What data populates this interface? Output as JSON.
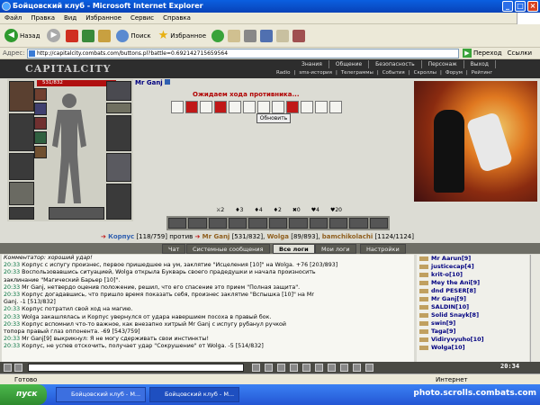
{
  "window": {
    "title": "Бойцовский клуб - Microsoft Internet Explorer"
  },
  "menu": [
    "Файл",
    "Правка",
    "Вид",
    "Избранное",
    "Сервис",
    "Справка"
  ],
  "toolbar": {
    "back": "Назад",
    "search": "Поиск",
    "favorites": "Избранное"
  },
  "address": {
    "label": "Адрес:",
    "url": "http://capitalcity.combats.com/buttons.pl?battle=0.692142715659564",
    "go": "Переход",
    "links": "Ссылки"
  },
  "game": {
    "logo": "CAPITALCITY",
    "top_links": [
      "Знания",
      "Общение",
      "Безопасность",
      "Персонаж",
      "Выход"
    ],
    "sub_links": [
      "Radio",
      "|",
      "sms-история",
      "|",
      "Телеграммы",
      "|",
      "События",
      "|",
      "Скроллы",
      "|",
      "Форум",
      "|",
      "Рейтинг"
    ],
    "player_hp": "531/832",
    "opponent": "Mr Ganj",
    "waiting": "Ожидаем хода противника...",
    "refresh": "Обновить",
    "stats": [
      "2",
      "3",
      "4",
      "2",
      "0",
      "4",
      "20"
    ],
    "vs": {
      "left": "Корпус",
      "left_hp": "[118/759]",
      "word": "против",
      "a": "Mr Ganj",
      "a_hp": "[531/832]",
      "b": "Wolga",
      "b_hp": "[89/893]",
      "c": "bamchikolachi",
      "c_hp": "[1124/1124]"
    }
  },
  "tabs": [
    "Чат",
    "Системные сообщения",
    "Все логи",
    "Мои логи",
    "Настройки"
  ],
  "chat": {
    "commentary": "Комментатор: хороший удар!",
    "lines": [
      {
        "time": "20:33",
        "text": "Корпус с испугу произнес, первое пришедшее на ум, заклятие \"Исцеления [10]\" на Wolga. +76 [203/893]"
      },
      {
        "time": "20:33",
        "text": "Воспользовавшись ситуацией, Wolga открыла Букварь своего прадедушки и начала произносить"
      },
      {
        "time": "",
        "text": "заклинание \"Магический Барьер [10]\"."
      },
      {
        "time": "20:33",
        "text": "Mr Ganj, нетвердо оценив положение, решил, что его спасение это прием \"Полная защита\"."
      },
      {
        "time": "20:33",
        "text": "Корпус догадавшись, что пришло время показать себя, произнес заклятие \"Вспышка [10]\" на Mr"
      },
      {
        "time": "",
        "text": "Ganj. -1 [513/832]"
      },
      {
        "time": "20:33",
        "text": "Корпус потратил свой ход на магию."
      },
      {
        "time": "20:33",
        "text": "Wolga закашлялась и Корпус увернулся от удара навершием посоха в правый бок."
      },
      {
        "time": "20:33",
        "text": "Корпус вспомнил что-то важное, как внезапно хитрый Mr Ganj с испугу рубанул ручкой"
      },
      {
        "time": "",
        "text": "топора правый глаз оппонента. -69 [543/759]"
      },
      {
        "time": "20:33",
        "text": "Mr Ganj[9] выкрикнул: Я не могу сдерживать свои инстинкты!"
      },
      {
        "time": "20:33",
        "text": "Корпус, не успев отскочить, получает удар \"Сокрушение\" от Wolga. -5 [514/832]"
      }
    ]
  },
  "users": [
    "Mr Aarun[9]",
    "justicecap[4]",
    "krit-o[10]",
    "Mey the Ani[9]",
    "dnd PESER[8]",
    "Mr Ganj[9]",
    "SALDIN[10]",
    "Solid Snayk[8]",
    "swin[9]",
    "Taga[9]",
    "Vidiryvyuho[10]",
    "Wolga[10]"
  ],
  "chatbar": {
    "clock": "20:34"
  },
  "status": {
    "ready": "Готово",
    "zone": "Интернет"
  },
  "taskbar": {
    "start": "пуск",
    "tasks": [
      "Бойцовский клуб - М...",
      "Бойцовский клуб - M..."
    ],
    "watermark": "photo.scrolls.combats.com"
  },
  "colors": {
    "titlebar": "#0842b8",
    "hp": "#b01010",
    "accent_red": "#c01010",
    "name_blue": "#3060b0"
  }
}
